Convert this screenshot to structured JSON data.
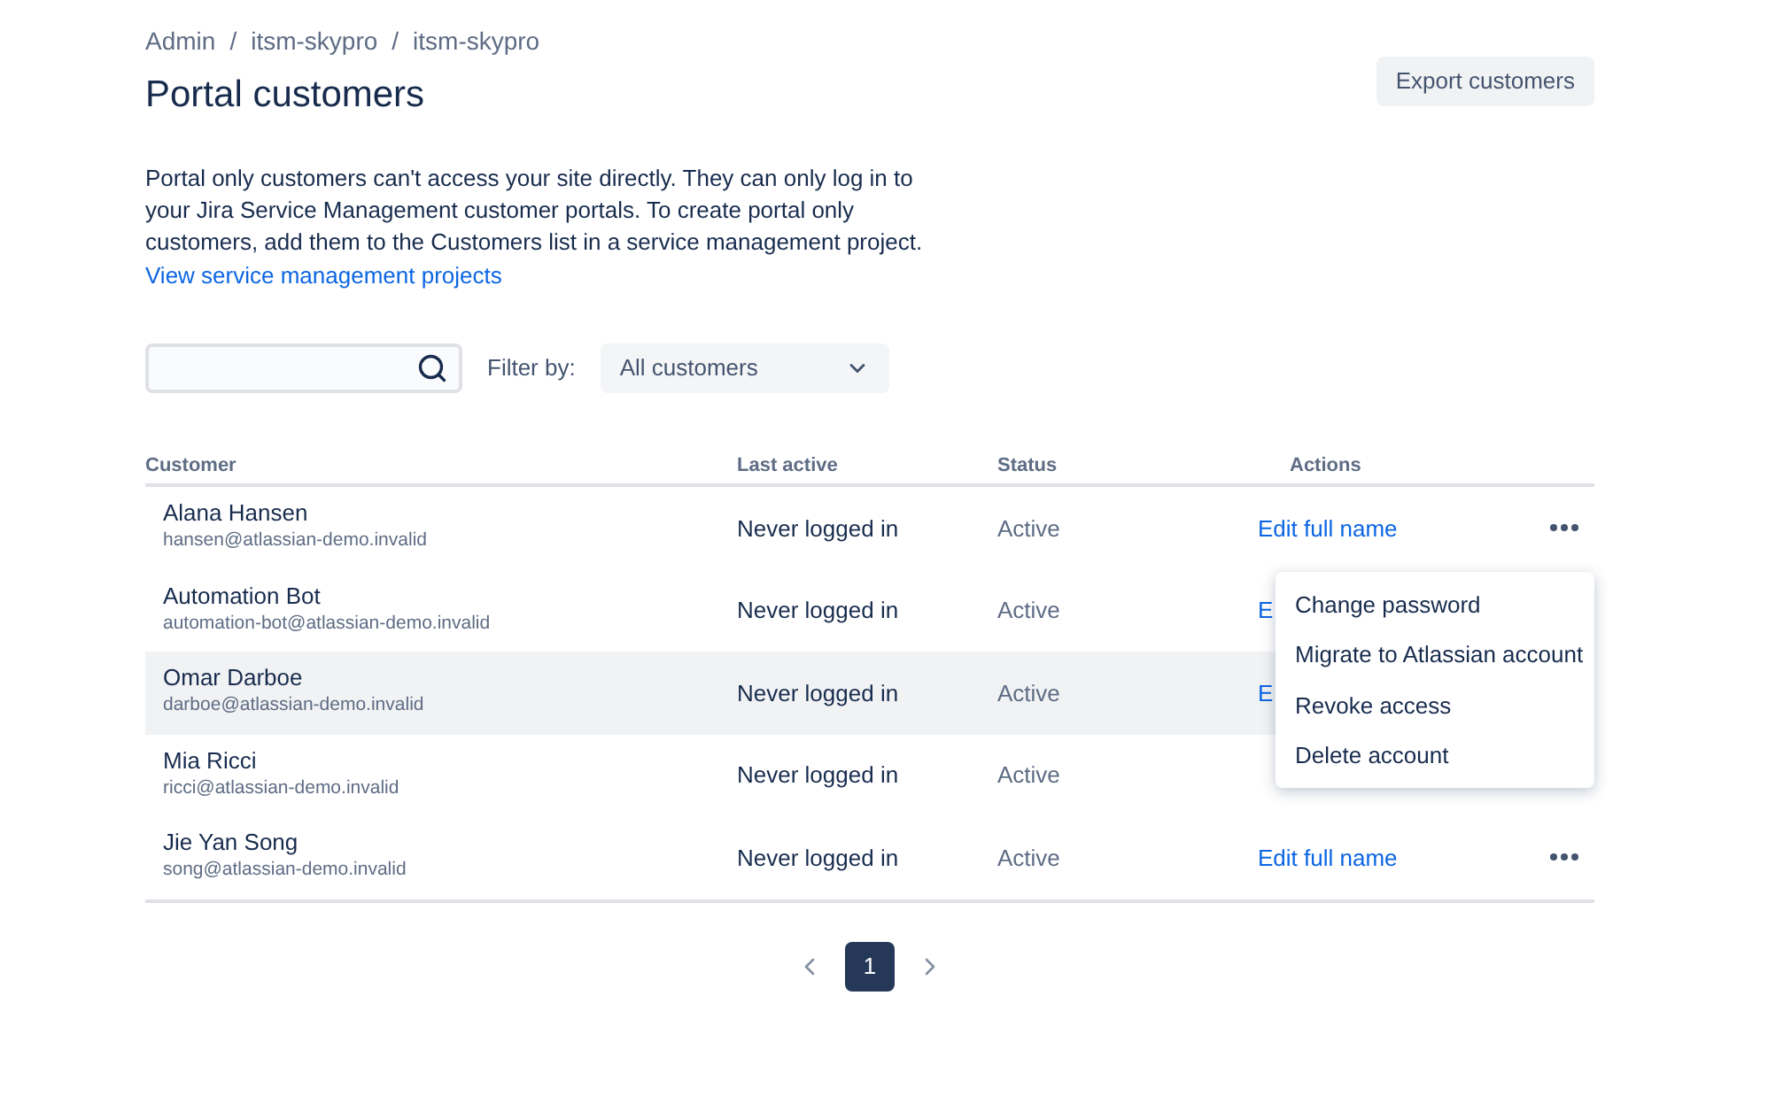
{
  "breadcrumbs": [
    "Admin",
    "itsm-skypro",
    "itsm-skypro"
  ],
  "breadcrumb_separator": "/",
  "title": "Portal customers",
  "export_button": "Export customers",
  "description": "Portal only customers can't access your site directly. They can only log in to your Jira Service Management customer portals. To create portal only customers, add them to the Customers list in a service management project.",
  "link": "View service management projects",
  "filter": {
    "label": "Filter by:",
    "value": "All customers"
  },
  "table": {
    "columns": [
      "Customer",
      "Last active",
      "Status",
      "Actions"
    ],
    "rows": [
      {
        "name": "Alana Hansen",
        "email": "hansen@atlassian-demo.invalid",
        "last_active": "Never logged in",
        "status": "Active",
        "action": "Edit full name",
        "highlighted": false,
        "kind": "menu"
      },
      {
        "name": "Automation Bot",
        "email": "automation-bot@atlassian-demo.invalid",
        "last_active": "Never logged in",
        "status": "Active",
        "action": "E",
        "highlighted": false,
        "kind": "covered"
      },
      {
        "name": "Omar Darboe",
        "email": "darboe@atlassian-demo.invalid",
        "last_active": "Never logged in",
        "status": "Active",
        "action": "E",
        "highlighted": true,
        "kind": "covered"
      },
      {
        "name": "Mia Ricci",
        "email": "ricci@atlassian-demo.invalid",
        "last_active": "Never logged in",
        "status": "Active",
        "highlighted": false,
        "kind": "covered"
      },
      {
        "name": "Jie Yan Song",
        "email": "song@atlassian-demo.invalid",
        "last_active": "Never logged in",
        "status": "Active",
        "action": "Edit full name",
        "highlighted": false,
        "kind": "normal"
      }
    ]
  },
  "menu": [
    "Change password",
    "Migrate to Atlassian account",
    "Revoke access",
    "Delete account"
  ],
  "pagination": [
    {
      "label": "1",
      "selected": true
    }
  ]
}
